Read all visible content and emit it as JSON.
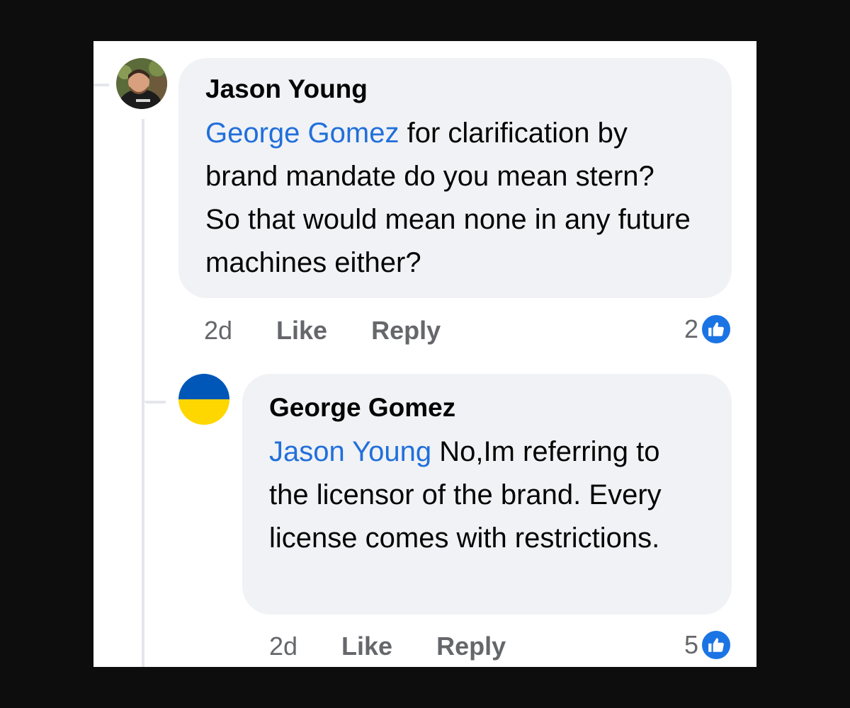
{
  "comments": [
    {
      "author": "Jason Young",
      "mention": "George Gomez",
      "text": " for clarification by brand mandate do you mean stern?  So that would mean none in any future machines either?",
      "time": "2d",
      "like_label": "Like",
      "reply_label": "Reply",
      "reaction_count": "2",
      "reaction_icon": "thumbs-up-icon",
      "avatar_icon": "profile-photo-avatar"
    },
    {
      "author": "George Gomez",
      "mention": "Jason Young",
      "text": " No,Im referring to the licensor of the brand. Every license comes with restrictions.",
      "time": "2d",
      "like_label": "Like",
      "reply_label": "Reply",
      "reaction_count": "5",
      "reaction_icon": "thumbs-up-icon",
      "avatar_icon": "ukraine-flag-avatar"
    }
  ],
  "colors": {
    "mention": "#216fdb",
    "bubble": "#f0f2f5",
    "like_badge": "#1b74e4",
    "flag_blue": "#0057b8",
    "flag_yellow": "#ffd700"
  }
}
